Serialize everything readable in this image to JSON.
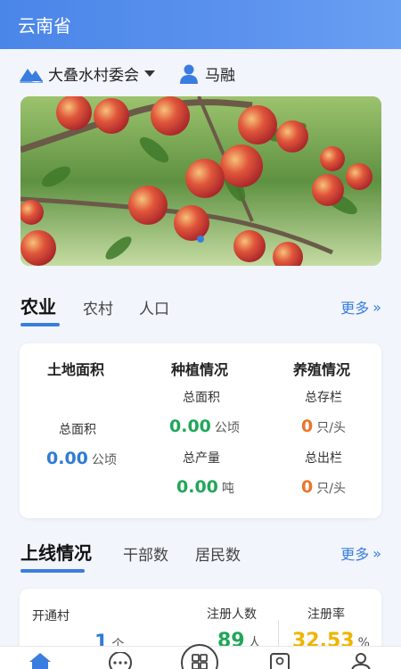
{
  "header": {
    "title": "云南省"
  },
  "selector": {
    "village": "大叠水村委会",
    "user": "马融"
  },
  "section1": {
    "tabs": [
      "农业",
      "农村",
      "人口"
    ],
    "more": "更多"
  },
  "agri_card": {
    "col1": {
      "title": "土地面积",
      "label": "总面积",
      "value": "0.00",
      "unit": "公顷"
    },
    "col2": {
      "title": "种植情况",
      "label1": "总面积",
      "value1": "0.00",
      "unit1": "公顷",
      "label2": "总产量",
      "value2": "0.00",
      "unit2": "吨"
    },
    "col3": {
      "title": "养殖情况",
      "label1": "总存栏",
      "value1": "0",
      "unit1": "只/头",
      "label2": "总出栏",
      "value2": "0",
      "unit2": "只/头"
    }
  },
  "section2": {
    "tabs": [
      "上线情况",
      "干部数",
      "居民数"
    ],
    "more": "更多"
  },
  "online_card": {
    "label1": "开通村",
    "value1": "1",
    "unit1": "个",
    "label2": "注册人数",
    "value2": "89",
    "unit2": "人",
    "label3": "注册率",
    "value3": "32.53",
    "unit3": "%"
  },
  "colors": {
    "accent": "#3a7de0",
    "blue_value": "#2f7bd6",
    "green_value": "#21a65a",
    "orange_value": "#e8762b",
    "yellow_value": "#f0b400"
  },
  "icons": {
    "village": "mountain-icon",
    "user": "person-icon",
    "nav": [
      "home-icon",
      "chat-icon",
      "grid-icon",
      "contacts-icon",
      "profile-icon"
    ]
  }
}
